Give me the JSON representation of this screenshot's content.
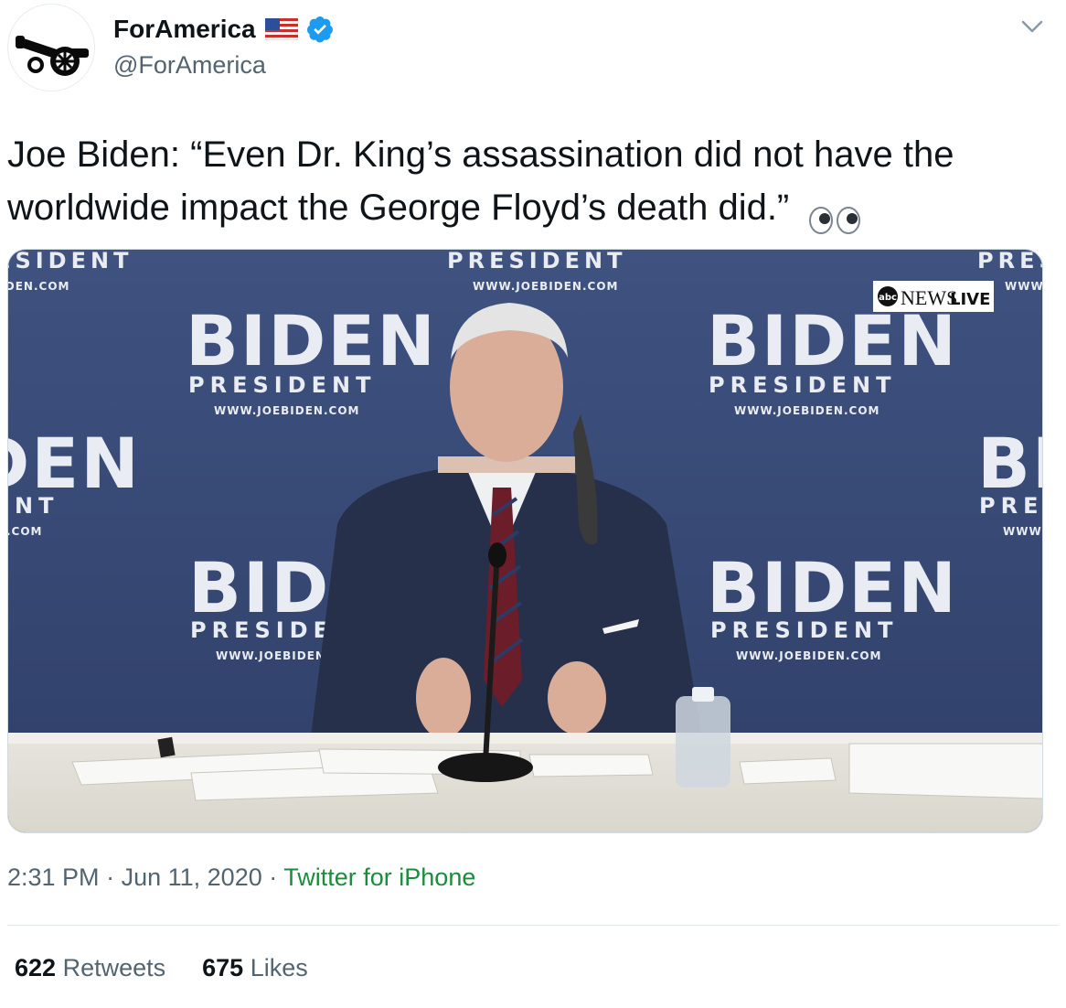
{
  "tweet": {
    "display_name": "ForAmerica",
    "handle": "@ForAmerica",
    "text": "Joe Biden: “Even Dr. King’s assassination did not have the worldwide impact the George Floyd’s death did.”",
    "time": "2:31 PM",
    "separator": "·",
    "date": "Jun 11, 2020",
    "source": "Twitter for iPhone",
    "retweets_count": "622",
    "retweets_label": "Retweets",
    "likes_count": "675",
    "likes_label": "Likes"
  },
  "media": {
    "backdrop": {
      "big_word": "BIDEN",
      "president": "PRESIDENT",
      "url": "WWW.JOEBIDEN.COM"
    },
    "news_bug": {
      "network": "abc",
      "label_main": "NEWS",
      "label_live": "LIVE"
    }
  },
  "icons": {
    "avatar": "cannon-logo",
    "flag": "us-flag-emoji",
    "verified": "verified-badge-icon",
    "menu": "chevron-down-icon",
    "emoji": "eyes-emoji"
  },
  "colors": {
    "verified_blue": "#1d9bf0",
    "source_green": "#1a8d3c",
    "secondary_text": "#536471",
    "backdrop_blue": "#3b4d78"
  }
}
